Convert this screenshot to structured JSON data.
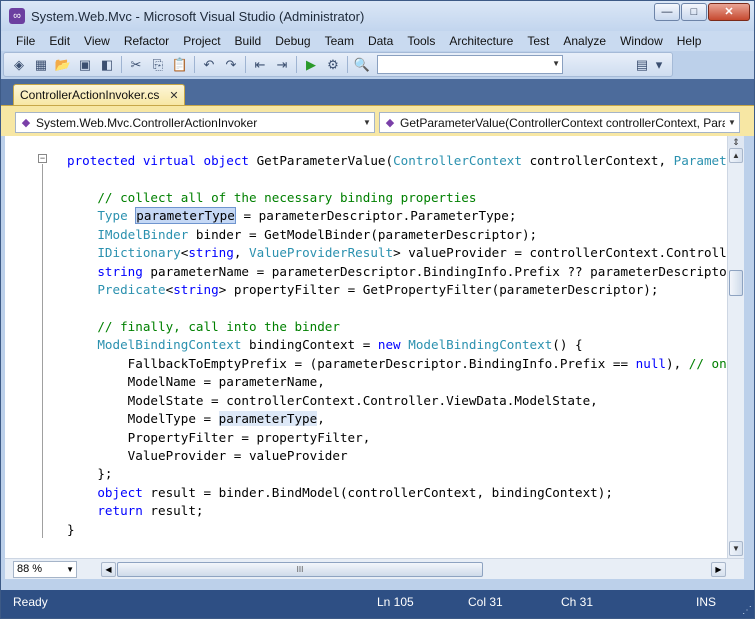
{
  "window": {
    "title": "System.Web.Mvc - Microsoft Visual Studio (Administrator)",
    "controls": {
      "minimize": "—",
      "maximize": "□",
      "close": "✕"
    }
  },
  "menu": [
    "File",
    "Edit",
    "View",
    "Refactor",
    "Project",
    "Build",
    "Debug",
    "Team",
    "Data",
    "Tools",
    "Architecture",
    "Test",
    "Analyze",
    "Window",
    "Help"
  ],
  "toolbar": {
    "search_value": ""
  },
  "tabs": [
    {
      "label": "ControllerActionInvoker.cs",
      "close": "✕"
    }
  ],
  "nav": {
    "type_combo": "System.Web.Mvc.ControllerActionInvoker",
    "member_combo": "GetParameterValue(ControllerContext controllerContext, Para"
  },
  "code_lines": [
    [
      [
        "kw",
        "protected"
      ],
      [
        "",
        " "
      ],
      [
        "kw",
        "virtual"
      ],
      [
        "",
        " "
      ],
      [
        "kw",
        "object"
      ],
      [
        "",
        " GetParameterValue("
      ],
      [
        "ty",
        "ControllerContext"
      ],
      [
        "",
        " controllerContext, "
      ],
      [
        "ty",
        "ParameterDescriptor"
      ]
    ],
    [],
    [
      [
        "",
        "    "
      ],
      [
        "cm",
        "// collect all of the necessary binding properties"
      ]
    ],
    [
      [
        "",
        "    "
      ],
      [
        "ty",
        "Type"
      ],
      [
        "",
        " "
      ],
      [
        "hl",
        "parameterType"
      ],
      [
        "",
        " = parameterDescriptor.ParameterType;"
      ]
    ],
    [
      [
        "",
        "    "
      ],
      [
        "ty",
        "IModelBinder"
      ],
      [
        "",
        " binder = GetModelBinder(parameterDescriptor);"
      ]
    ],
    [
      [
        "",
        "    "
      ],
      [
        "ty",
        "IDictionary"
      ],
      [
        "",
        "<"
      ],
      [
        "kw",
        "string"
      ],
      [
        "",
        ", "
      ],
      [
        "ty",
        "ValueProviderResult"
      ],
      [
        "",
        "> valueProvider = controllerContext.Controller.ValueProvider;"
      ]
    ],
    [
      [
        "",
        "    "
      ],
      [
        "kw",
        "string"
      ],
      [
        "",
        " parameterName = parameterDescriptor.BindingInfo.Prefix ?? parameterDescriptor.ParameterName;"
      ]
    ],
    [
      [
        "",
        "    "
      ],
      [
        "ty",
        "Predicate"
      ],
      [
        "",
        "<"
      ],
      [
        "kw",
        "string"
      ],
      [
        "",
        "> propertyFilter = GetPropertyFilter(parameterDescriptor);"
      ]
    ],
    [],
    [
      [
        "",
        "    "
      ],
      [
        "cm",
        "// finally, call into the binder"
      ]
    ],
    [
      [
        "",
        "    "
      ],
      [
        "ty",
        "ModelBindingContext"
      ],
      [
        "",
        " bindingContext = "
      ],
      [
        "kw",
        "new"
      ],
      [
        "",
        " "
      ],
      [
        "ty",
        "ModelBindingContext"
      ],
      [
        "",
        "() {"
      ]
    ],
    [
      [
        "",
        "        FallbackToEmptyPrefix = (parameterDescriptor.BindingInfo.Prefix == "
      ],
      [
        "kw",
        "null"
      ],
      [
        "",
        "), "
      ],
      [
        "cm",
        "// only fall back if prefix not specified"
      ]
    ],
    [
      [
        "",
        "        ModelName = parameterName,"
      ]
    ],
    [
      [
        "",
        "        ModelState = controllerContext.Controller.ViewData.ModelState,"
      ]
    ],
    [
      [
        "",
        "        ModelType = "
      ],
      [
        "hl2",
        "parameterType"
      ],
      [
        "",
        ","
      ]
    ],
    [
      [
        "",
        "        PropertyFilter = propertyFilter,"
      ]
    ],
    [
      [
        "",
        "        ValueProvider = valueProvider"
      ]
    ],
    [
      [
        "",
        "    };"
      ]
    ],
    [
      [
        "",
        "    "
      ],
      [
        "kw",
        "object"
      ],
      [
        "",
        " result = binder.BindModel(controllerContext, bindingContext);"
      ]
    ],
    [
      [
        "",
        "    "
      ],
      [
        "kw",
        "return"
      ],
      [
        "",
        " result;"
      ]
    ],
    [
      [
        "",
        "}"
      ]
    ]
  ],
  "editor": {
    "zoom": "88 %",
    "hscroll_grip": "III"
  },
  "status": {
    "state": "Ready",
    "line": "Ln 105",
    "col": "Col 31",
    "ch": "Ch 31",
    "mode": "INS"
  }
}
